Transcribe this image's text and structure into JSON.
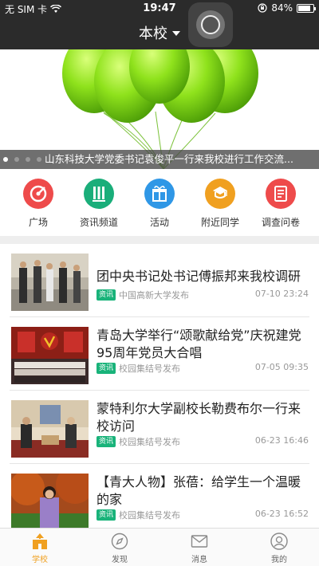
{
  "status_bar": {
    "carrier": "无 SIM 卡",
    "time": "19:47",
    "battery": "84%",
    "battery_level": 0.84
  },
  "nav": {
    "title": "本校"
  },
  "banner": {
    "caption": "山东科技大学党委书记袁俊平一行来我校进行工作交流...",
    "slide_count": 4,
    "active_slide": 0
  },
  "quick_links": [
    {
      "label": "广场",
      "icon": "square-target-icon",
      "color": "#ee4b4b"
    },
    {
      "label": "资讯频道",
      "icon": "news-channel-icon",
      "color": "#1aae7a"
    },
    {
      "label": "活动",
      "icon": "gift-icon",
      "color": "#2f97e6"
    },
    {
      "label": "附近同学",
      "icon": "nearby-classmates-icon",
      "color": "#f0a020"
    },
    {
      "label": "调查问卷",
      "icon": "survey-icon",
      "color": "#ee4b4b"
    }
  ],
  "news": [
    {
      "title": "团中央书记处书记傅振邦来我校调研",
      "tag": "资讯",
      "source": "中国高新大学发布",
      "date": "07-10 23:24"
    },
    {
      "title": "青岛大学举行“颂歌献给党”庆祝建党95周年党员大合唱",
      "tag": "资讯",
      "source": "校园集结号发布",
      "date": "07-05 09:35"
    },
    {
      "title": "蒙特利尔大学副校长勒费布尔一行来校访问",
      "tag": "资讯",
      "source": "校园集结号发布",
      "date": "06-23 16:46"
    },
    {
      "title": "【青大人物】张蓓：给学生一个温暖的家",
      "tag": "资讯",
      "source": "校园集结号发布",
      "date": "06-23 16:52"
    }
  ],
  "tabs": [
    {
      "label": "学校",
      "icon": "school-icon",
      "active": true
    },
    {
      "label": "发现",
      "icon": "compass-icon",
      "active": false
    },
    {
      "label": "消息",
      "icon": "mail-icon",
      "active": false
    },
    {
      "label": "我的",
      "icon": "profile-icon",
      "active": false
    }
  ],
  "colors": {
    "accent": "#f0a020",
    "tag": "#19b37a",
    "nav_bg": "#2b2b2b"
  }
}
